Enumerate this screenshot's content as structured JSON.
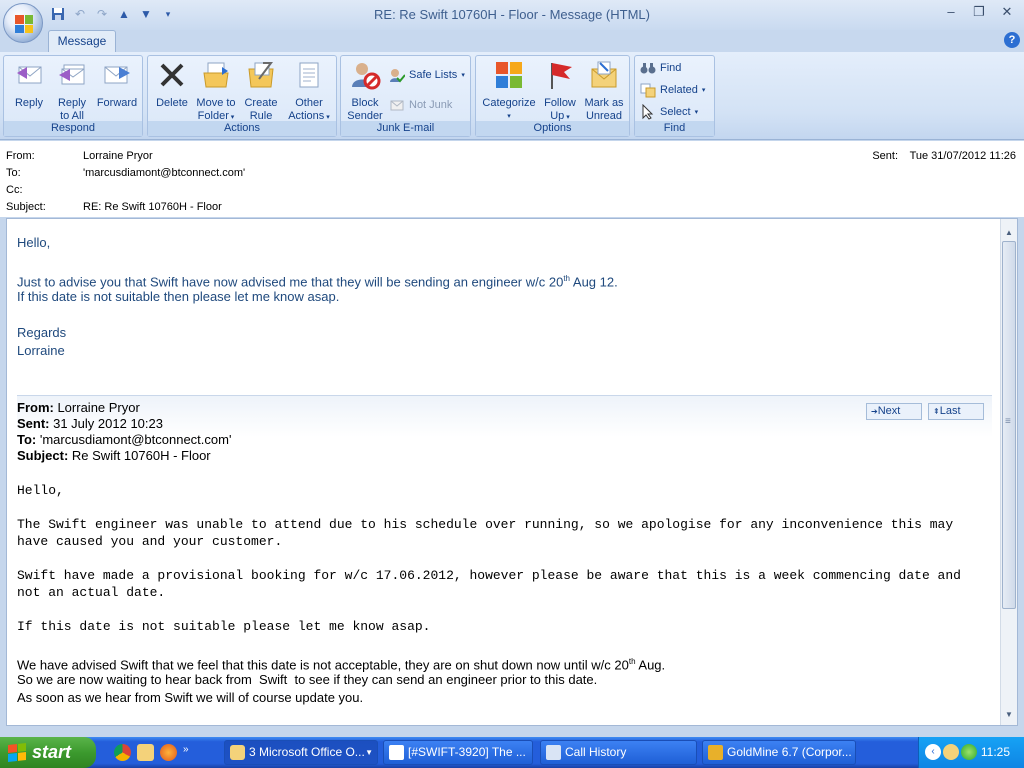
{
  "window": {
    "title": "RE: Re Swift 10760H - Floor - Message (HTML)"
  },
  "ribbon": {
    "tab": "Message",
    "groups": {
      "respond": {
        "label": "Respond",
        "reply": "Reply",
        "reply_all_1": "Reply",
        "reply_all_2": "to All",
        "forward": "Forward"
      },
      "actions": {
        "label": "Actions",
        "delete": "Delete",
        "move_1": "Move to",
        "move_2": "Folder",
        "create_1": "Create",
        "create_2": "Rule",
        "other_1": "Other",
        "other_2": "Actions"
      },
      "junk": {
        "label": "Junk E-mail",
        "block_1": "Block",
        "block_2": "Sender",
        "safe_lists": "Safe Lists",
        "not_junk": "Not Junk"
      },
      "options": {
        "label": "Options",
        "categorize": "Categorize",
        "follow_1": "Follow",
        "follow_2": "Up",
        "mark_1": "Mark as",
        "mark_2": "Unread"
      },
      "find": {
        "label": "Find",
        "find": "Find",
        "related": "Related",
        "select": "Select"
      }
    }
  },
  "headers": {
    "from_label": "From:",
    "from_value": "Lorraine Pryor",
    "to_label": "To:",
    "to_value": "'marcusdiamont@btconnect.com'",
    "cc_label": "Cc:",
    "cc_value": "",
    "subject_label": "Subject:",
    "subject_value": "RE: Re Swift 10760H - Floor",
    "sent_label": "Sent:",
    "sent_value": "Tue 31/07/2012 11:26"
  },
  "message": {
    "greeting": "Hello,",
    "line1_pre": "Just to advise you that Swift have now advised me that they will be sending an engineer w/c 20",
    "line1_sup": "th",
    "line1_post": " Aug 12.",
    "line2": "If this date is not suitable then please let me know asap.",
    "regards": "Regards",
    "signature": "Lorraine"
  },
  "quoted": {
    "nav_next": "Next",
    "nav_last": "Last",
    "from_label": "From:",
    "from_value": " Lorraine Pryor",
    "sent_label": "Sent:",
    "sent_value": " 31 July 2012 10:23",
    "to_label": "To:",
    "to_value": " 'marcusdiamont@btconnect.com'",
    "subject_label": "Subject:",
    "subject_value": " Re Swift 10760H - Floor",
    "greeting": "Hello,",
    "para1": "The Swift engineer was unable to attend due to his schedule over running, so we apologise for any inconvenience this may have caused you and your customer.",
    "para2": "Swift have made a provisional booking for w/c 17.06.2012, however please be aware that this is a week commencing date and not an actual date.",
    "para3": "If this date is not suitable please let me know asap.",
    "para4_pre": "We have advised Swift that we feel that this date is not acceptable, they are on shut down now until w/c 20",
    "para4_sup": "th",
    "para4_post": " Aug.",
    "para5": "So we are now waiting to hear back from  Swift  to see if they can send an engineer prior to this date.",
    "para6": "As soon as we hear from Swift we will of course update you."
  },
  "taskbar": {
    "start": "start",
    "tasks": [
      "3 Microsoft Office O...",
      "[#SWIFT-3920] The ...",
      "Call History",
      "GoldMine 6.7 (Corpor..."
    ],
    "clock": "11:25"
  },
  "colors": {
    "accent": "#15428b",
    "body_text": "#1f497d",
    "taskbar": "#245edb",
    "start": "#3c9a2e"
  }
}
